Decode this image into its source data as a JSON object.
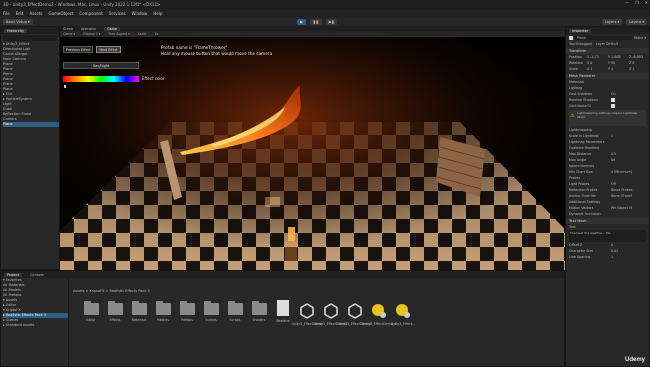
{
  "window": {
    "title": "3D - Unity3_EffectDemo2 - Windows, Mac, Linux - Unity 2022.1.13f1* <DX11>",
    "controls": [
      "—",
      "❐",
      "✕"
    ]
  },
  "menu": [
    "File",
    "Edit",
    "Assets",
    "GameObject",
    "Component",
    "Services",
    "Window",
    "Help"
  ],
  "toolbar": {
    "account": "Basic Virtuo ▾",
    "play": "▶",
    "pause": "❚❚",
    "step": "▶❚",
    "layers": "Layers ▾",
    "layout": "Layout ▾"
  },
  "hierarchy": {
    "tab": "Hierarchy",
    "items": [
      "▾ Unity3_Effect",
      "  Directional Ligh",
      "  CameraTarget",
      "  Main Camera",
      "  Plane",
      "  Plane",
      "  Plane",
      "  Plane",
      "  Plane",
      "  Plane",
      "▸ Ctrl",
      "▸ ParticleSystem",
      "  Light",
      "  Cube",
      "  Reflection Probe",
      "  Camera",
      "  Plane"
    ]
  },
  "scene": {
    "tabs": [
      "Scene",
      "Animator",
      "Game"
    ],
    "active_tab": "Game",
    "game_toolbar": [
      "Game ▾",
      "Display 1 ▾",
      "Free Aspect ▾",
      "Scale",
      "1x"
    ],
    "prev_btn": "Previous Effect",
    "next_btn": "Next Effect",
    "daynight_btn": "Day/Night",
    "color_label": "Effect color",
    "prefab_text": "Prefab name is \"FlameThrower\"",
    "hint_text": "Hold any mouse button that would move the camera"
  },
  "inspector": {
    "tab": "Inspector",
    "object_name": "Plane",
    "static": "Static ▾",
    "tag": "Tag Untagged",
    "layer": "Layer Default",
    "transform": "Transform",
    "position": [
      "Position",
      "X -4.75",
      "Y 1.008",
      "Z -6.893"
    ],
    "rotation": [
      "Rotation",
      "X 0",
      "Y 90",
      "Z 0"
    ],
    "scale": [
      "Scale",
      "X 1",
      "Y 1",
      "Z 1"
    ],
    "mesh_renderer": "Mesh Renderer",
    "sections": [
      "Materials",
      "Lighting",
      "Cast Shadows",
      "Receive Shadows",
      "Contribute GI",
      "Lightmapping",
      "Scale In Lightmap",
      "Lightmap Parameters",
      "Optimize Realtime",
      "Max Distance",
      "Max Angle",
      "Ignore Normals",
      "Min Chart Size",
      "Probes",
      "Light Probes",
      "Reflection Probes",
      "Anchor Override",
      "Additional Settings",
      "Motion Vectors",
      "Dynamic Occlusion",
      "Text Mesh",
      "Text",
      "Offset Z",
      "Character Size",
      "Line Spacing"
    ],
    "values": {
      "cast": "On",
      "receive": "",
      "gi": "",
      "scale_lm": "1",
      "max_dist": "0.5",
      "max_angle": "89",
      "chart": "4 (Minimum)",
      "lightprobes": "Off",
      "refl": "Blend Probes",
      "anchor": "None (Transf",
      "motion": "Per Object M",
      "offset": "0",
      "charsize": "0.02",
      "linesp": "1"
    },
    "warning": "Lightmapping settings require Lightmap Static",
    "text_value": "The heat the weather... file"
  },
  "project": {
    "tabs": [
      "Project",
      "Console"
    ],
    "breadcrumb": "Assets > KriptoFX > Realistic Effects Pack 3",
    "tree": [
      "▾ Favorites",
      "  All Materials",
      "  All Models",
      "  All Prefabs",
      "▾ Assets",
      "  ▸ Editor",
      "  ▾ KriptoFX",
      "    ▸ Realistic Effects Pack 3",
      "  ▸ Scenes",
      "  ▸ Standard Assets"
    ],
    "assets": [
      "Editor",
      "Effects",
      "Materials",
      "Meshes",
      "Prefabs",
      "Scenes",
      "Scripts",
      "Shaders",
      "Readme",
      "Unity3_EffectDemo",
      "Unity3_EffectDemo2",
      "Unity3_EffectDemo3",
      "Unity3_EffectDemo_s",
      "Unity3_Effect..."
    ]
  },
  "watermark": "Udemy",
  "colors": {
    "bg": "#191919",
    "panel": "#282828",
    "accent": "#2c5d87",
    "flame": "#ff7a1a"
  }
}
